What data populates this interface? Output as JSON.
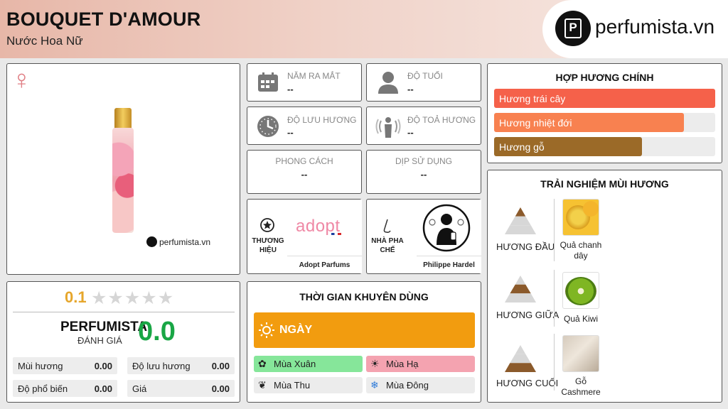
{
  "header": {
    "title": "BOUQUET D'AMOUR",
    "subtitle": "Nước Hoa Nữ",
    "logo_text": "perfumista.vn",
    "logo_letter": "P"
  },
  "product": {
    "gender_icon": "venus-icon",
    "watermark": "perfumista.vn"
  },
  "info": {
    "launch_year": {
      "label": "NĂM RA MẮT",
      "value": "--",
      "icon": "calendar-icon"
    },
    "age": {
      "label": "ĐỘ TUỔI",
      "value": "--",
      "icon": "person-icon"
    },
    "longevity": {
      "label": "ĐỘ LƯU HƯƠNG",
      "value": "--",
      "icon": "clock-icon"
    },
    "sillage": {
      "label": "ĐỘ TOẢ HƯƠNG",
      "value": "--",
      "icon": "diffusion-icon"
    },
    "style": {
      "label": "PHONG CÁCH",
      "value": "--"
    },
    "occasion": {
      "label": "DỊP SỬ DỤNG",
      "value": "--"
    },
    "brand": {
      "label": "THƯƠNG HIỆU",
      "logo": "adopt",
      "name": "Adopt Parfums",
      "icon": "star-badge-icon"
    },
    "perfumer": {
      "label": "NHÀ PHA CHẾ",
      "name": "Philippe Hardel",
      "icon": "nose-icon"
    }
  },
  "rating": {
    "score": "0.1",
    "stars_total": 5,
    "stars_filled": 0,
    "perfumista_label": "PERFUMISTA",
    "perfumista_sub": "ĐÁNH GIÁ",
    "perfumista_score": "0.0",
    "metrics": [
      {
        "name": "Mùi hương",
        "value": "0.00"
      },
      {
        "name": "Độ lưu hương",
        "value": "0.00"
      },
      {
        "name": "Độ phổ biến",
        "value": "0.00"
      },
      {
        "name": "Giá",
        "value": "0.00"
      }
    ]
  },
  "accords": {
    "title": "HỢP HƯƠNG CHÍNH",
    "items": [
      {
        "name": "Hương trái cây",
        "level": 1.0,
        "color": "#f5614a"
      },
      {
        "name": "Hương nhiệt đới",
        "level": 0.86,
        "color": "#f88150"
      },
      {
        "name": "Hương gỗ",
        "level": 0.67,
        "color": "#9b6a28"
      }
    ]
  },
  "recommend": {
    "title": "THỜI GIAN KHUYÊN DÙNG",
    "day_label": "NGÀY",
    "day_color": "#f29c0f",
    "seasons": [
      {
        "name": "Mùa Xuân",
        "color": "#86e69a",
        "icon": "flower-icon"
      },
      {
        "name": "Mùa Hạ",
        "color": "#f4a3b0",
        "icon": "sun-icon"
      },
      {
        "name": "Mùa Thu",
        "color": "#ececec",
        "icon": "leaf-icon"
      },
      {
        "name": "Mùa Đông",
        "color": "#ececec",
        "icon": "snowflake-icon"
      }
    ]
  },
  "notes": {
    "title": "TRẢI NGHIỆM MÙI HƯƠNG",
    "levels": [
      {
        "label": "HƯƠNG ĐẦU",
        "note": "Quả chanh dây"
      },
      {
        "label": "HƯƠNG GIỮA",
        "note": "Quả Kiwi"
      },
      {
        "label": "HƯƠNG CUỐI",
        "note": "Gỗ Cashmere"
      }
    ]
  }
}
